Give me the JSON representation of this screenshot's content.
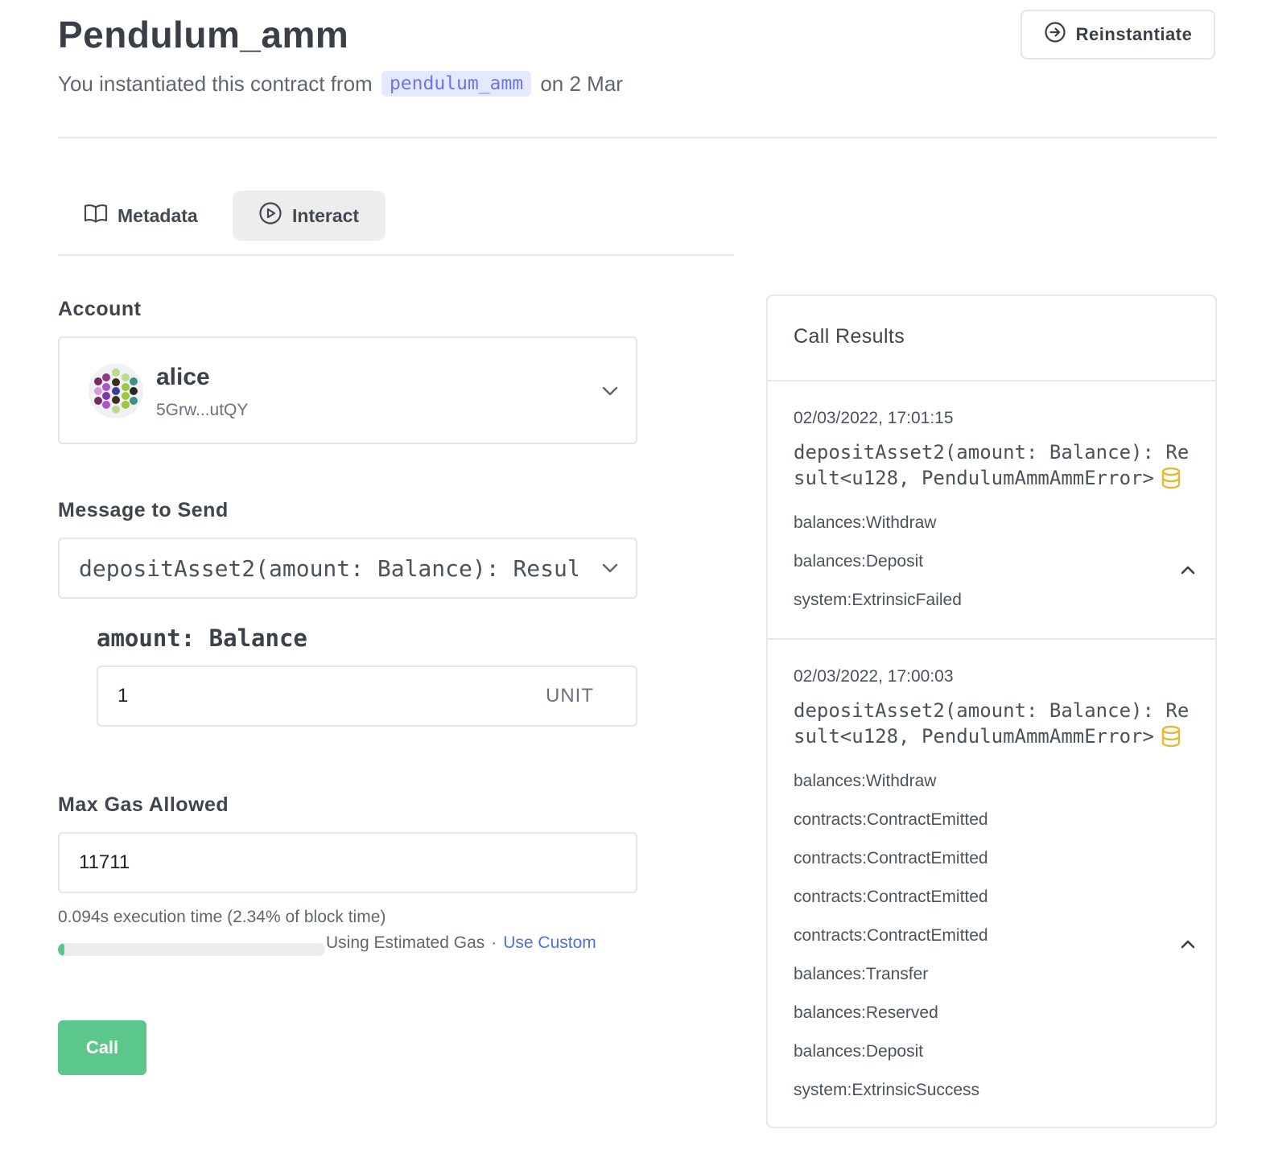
{
  "header": {
    "title": "Pendulum_amm",
    "subtitle_prefix": "You instantiated this contract from",
    "code_name": "pendulum_amm",
    "subtitle_suffix": "on 2 Mar",
    "reinstantiate_label": "Reinstantiate"
  },
  "tabs": [
    {
      "label": "Metadata",
      "icon": "book-icon"
    },
    {
      "label": "Interact",
      "icon": "play-circle-icon",
      "active": true
    }
  ],
  "form": {
    "account_label": "Account",
    "account": {
      "name": "alice",
      "address": "5Grw...utQY"
    },
    "message_label": "Message to Send",
    "message_value": "depositAsset2(amount: Balance): Result<u128, PendulumAmmAmmError>",
    "arg_label": "amount: Balance",
    "amount_value": "1",
    "amount_unit": "UNIT",
    "gas_label": "Max Gas Allowed",
    "gas_value": "11711",
    "exec_time": "0.094s execution time (2.34% of block time)",
    "gas_progress_percent": 2.34,
    "gas_mode": "Using Estimated Gas",
    "gas_separator": "·",
    "use_custom": "Use Custom",
    "call_label": "Call"
  },
  "results": {
    "title": "Call Results",
    "entries": [
      {
        "timestamp": "02/03/2022, 17:01:15",
        "signature": "depositAsset2(amount: Balance): Result<u128, PendulumAmmAmmError>",
        "events": [
          "balances:Withdraw",
          "balances:Deposit",
          "system:ExtrinsicFailed"
        ]
      },
      {
        "timestamp": "02/03/2022, 17:00:03",
        "signature": "depositAsset2(amount: Balance): Result<u128, PendulumAmmAmmError>",
        "events": [
          "balances:Withdraw",
          "contracts:ContractEmitted",
          "contracts:ContractEmitted",
          "contracts:ContractEmitted",
          "contracts:ContractEmitted",
          "balances:Transfer",
          "balances:Reserved",
          "balances:Deposit",
          "system:ExtrinsicSuccess"
        ]
      }
    ]
  },
  "colors": {
    "accent_green": "#5cc78a",
    "link_blue": "#4c72d8",
    "chip_bg": "#e5e9ff",
    "chip_text": "#6a76e4",
    "coin_yellow": "#e8b930"
  }
}
